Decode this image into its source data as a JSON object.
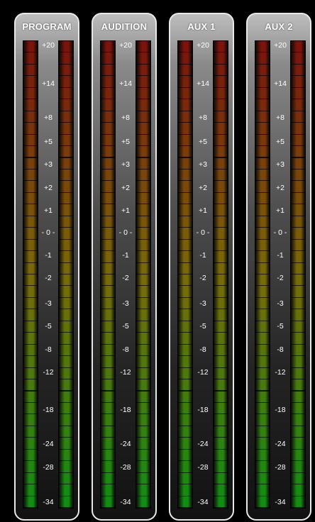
{
  "meters": [
    {
      "id": "program",
      "title": "PROGRAM"
    },
    {
      "id": "audition",
      "title": "AUDITION"
    },
    {
      "id": "aux1",
      "title": "AUX 1"
    },
    {
      "id": "aux2",
      "title": "AUX 2"
    }
  ],
  "scale_labels": [
    "+20",
    "+14",
    "+8",
    "+5",
    "+3",
    "+2",
    "+1",
    "- 0 -",
    "-1",
    "-2",
    "-3",
    "-5",
    "-8",
    "-12",
    "-18",
    "-24",
    "-28",
    "-34"
  ],
  "segment_count": 40,
  "colors": {
    "background": "#000000",
    "border": "#e9e9e9",
    "segment_top": "#7a140c",
    "segment_mid": "#7a6a08",
    "segment_bottom": "#128c12",
    "label": "#ffffff"
  }
}
